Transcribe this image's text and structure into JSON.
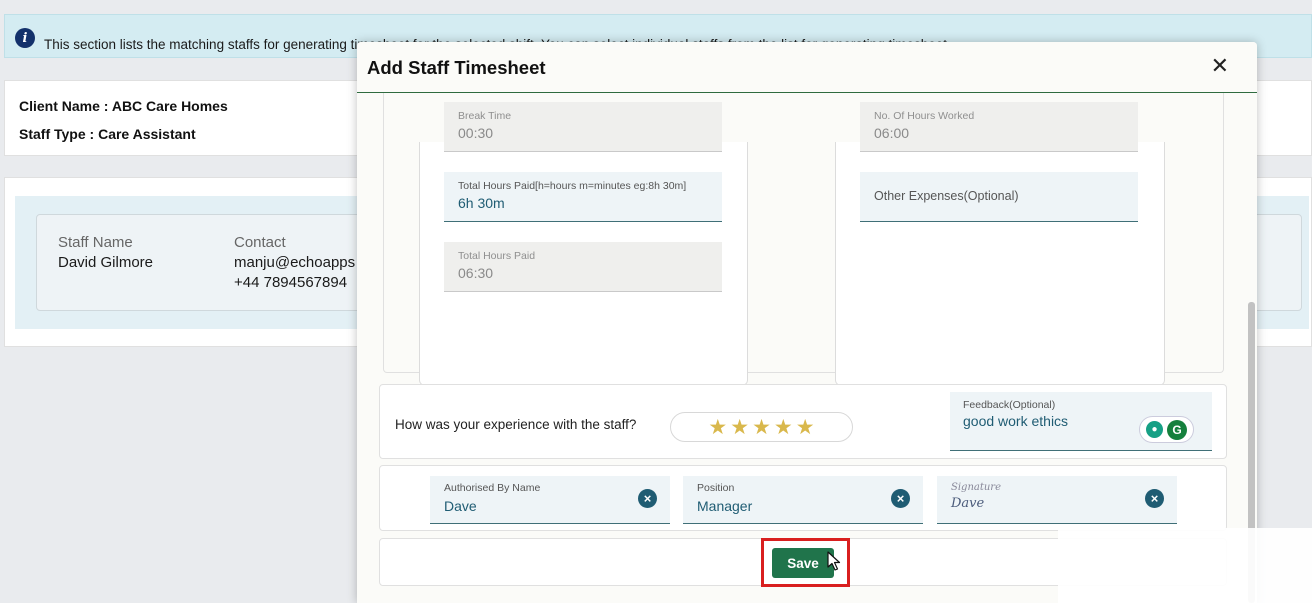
{
  "banner": {
    "icon": "info-icon",
    "text": "This section lists the matching staffs for generating timesheet for the selected shift. You can select individual staffs from the list for generating timesheet."
  },
  "client": {
    "client_name": "Client Name : ABC Care Homes",
    "staff_type": "Staff Type : Care Assistant"
  },
  "staff_list": {
    "staff_name_label": "Staff Name",
    "staff_name": "David Gilmore",
    "contact_label": "Contact",
    "email": "manju@echoapps",
    "phone": "+44 7894567894"
  },
  "modal": {
    "title": "Add Staff Timesheet",
    "close": "✕",
    "fields": {
      "break_time": {
        "label": "Break Time",
        "value": "00:30"
      },
      "hours_worked": {
        "label": "No. Of Hours Worked",
        "value": "06:00"
      },
      "total_hours_paid_input": {
        "label": "Total Hours Paid[h=hours m=minutes eg:8h 30m]",
        "value": "6h 30m"
      },
      "other_expenses": {
        "placeholder": "Other Expenses(Optional)"
      },
      "total_hours_paid": {
        "label": "Total Hours Paid",
        "value": "06:30"
      }
    },
    "rating": {
      "question": "How was your experience with the staff?",
      "stars": 5,
      "max": 5
    },
    "feedback": {
      "label": "Feedback(Optional)",
      "value": "good work ethics"
    },
    "authorisation": {
      "name_label": "Authorised By Name",
      "name_value": "Dave",
      "position_label": "Position",
      "position_value": "Manager",
      "signature_label": "Signature",
      "signature_value": "Dave"
    },
    "save_label": "Save"
  },
  "colors": {
    "save_button": "#20744b",
    "highlight": "#d91f1f",
    "star": "#d9b84c",
    "banner": "#d4ecf2"
  }
}
